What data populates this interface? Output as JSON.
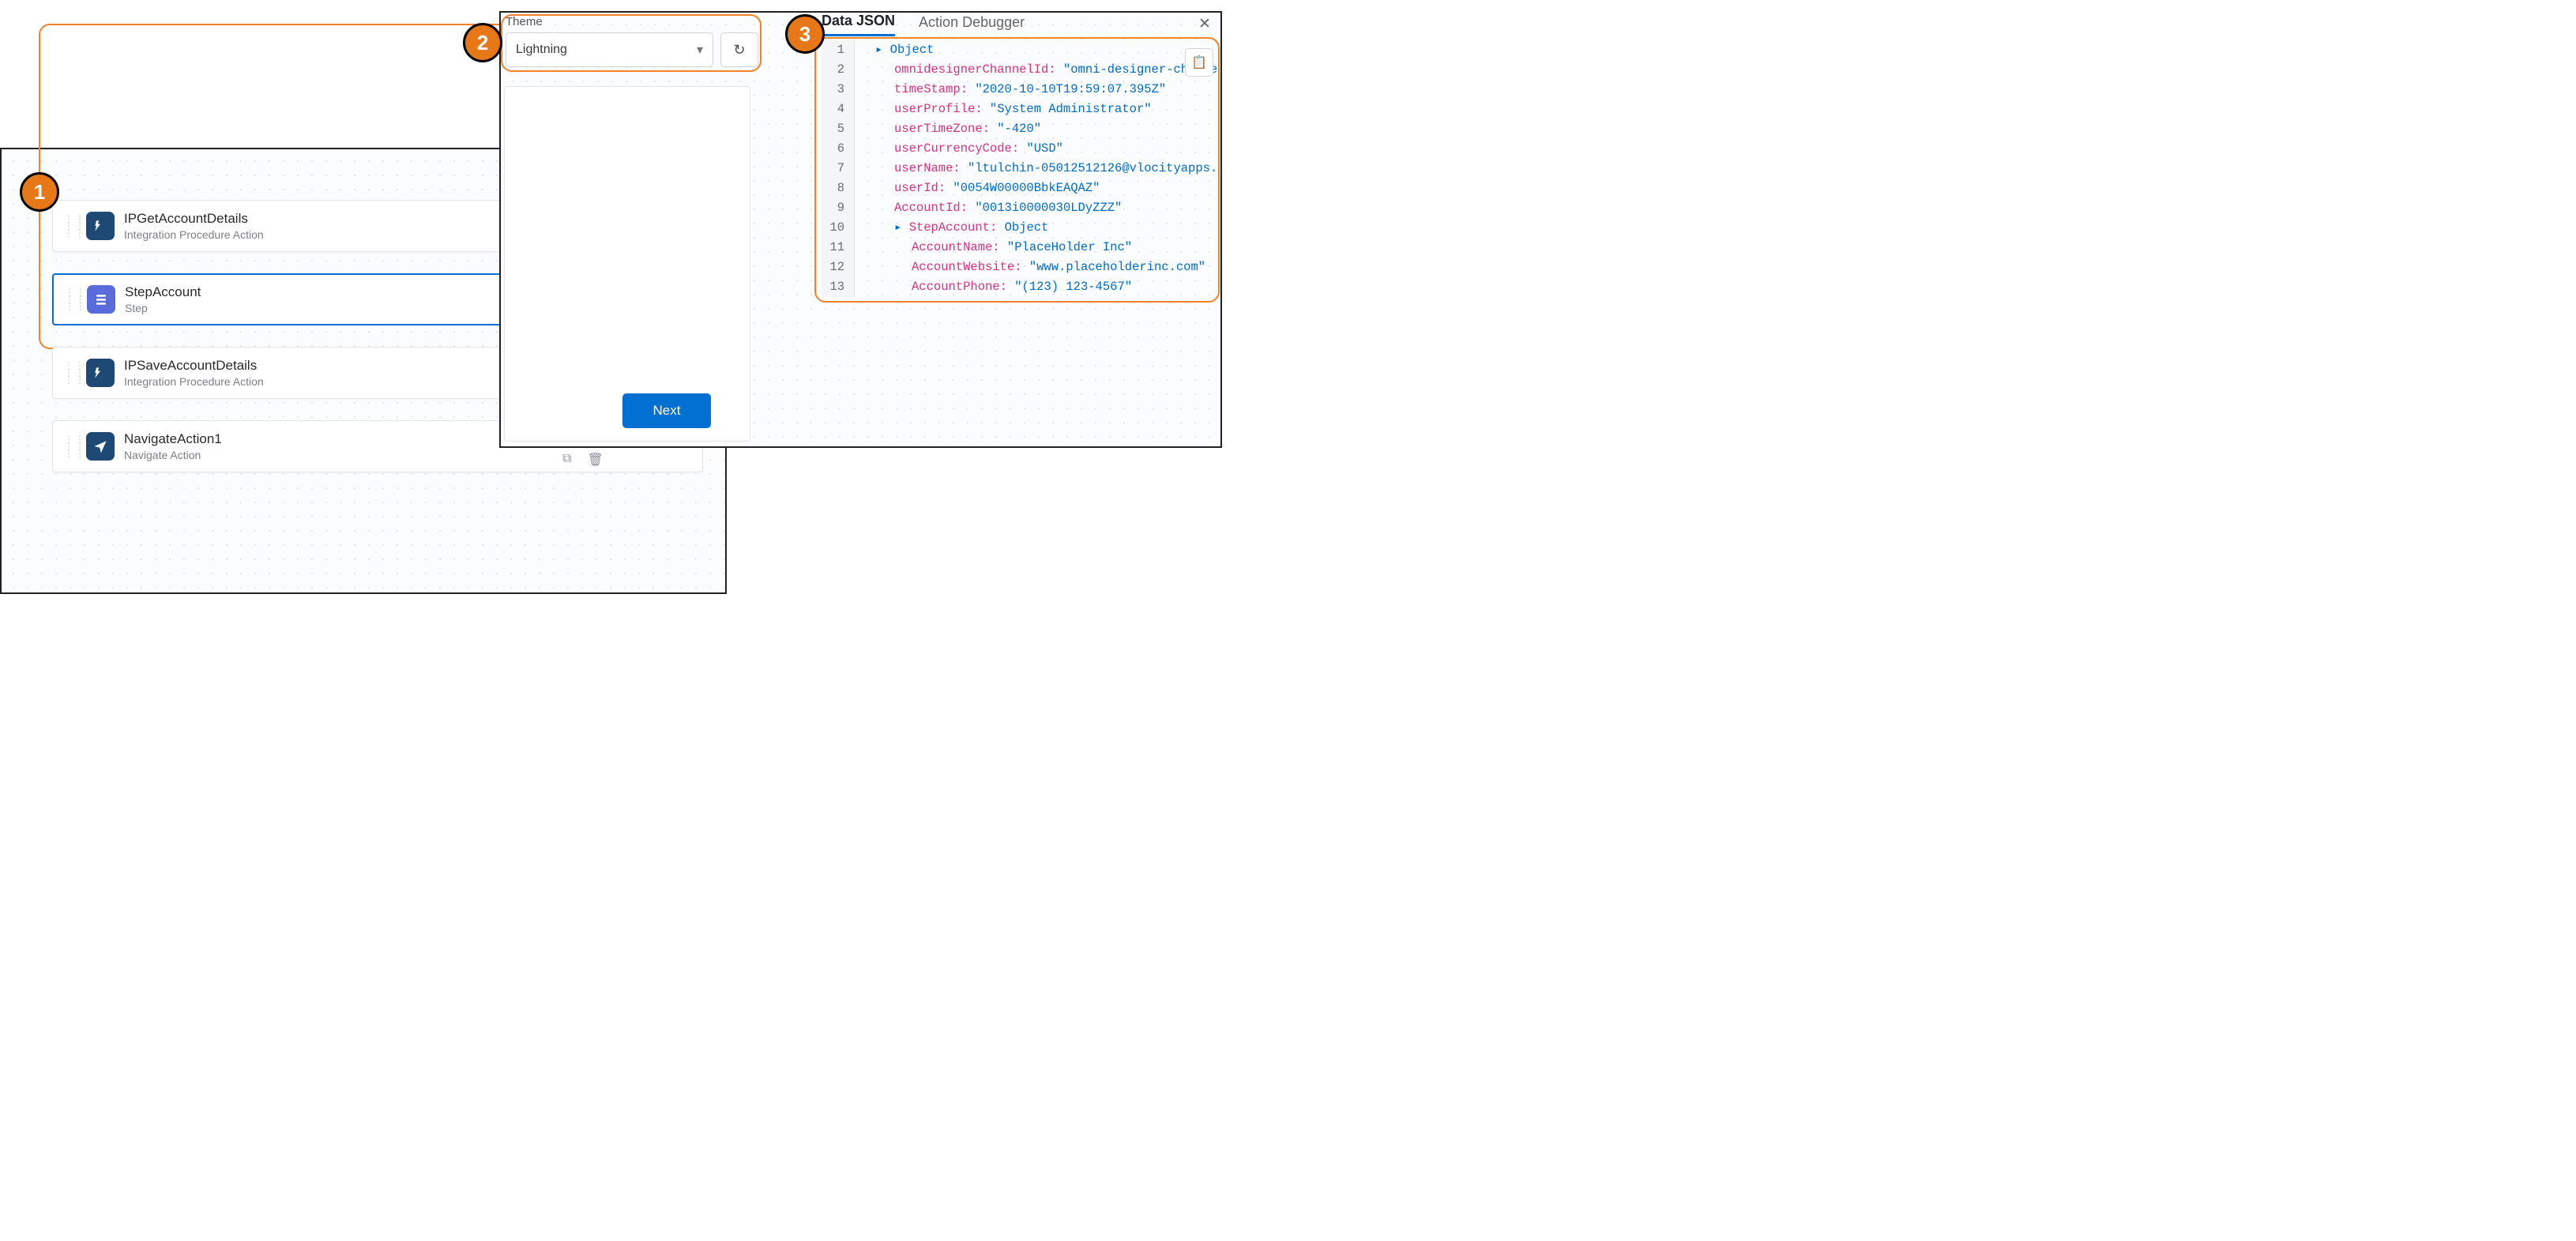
{
  "callouts": {
    "b1": "1",
    "b2": "2",
    "b3": "3"
  },
  "theme": {
    "label": "Theme",
    "value": "Lightning"
  },
  "preview": {
    "next_label": "Next"
  },
  "tabs": {
    "data_json": "Data JSON",
    "action_debugger": "Action Debugger"
  },
  "json_lines": [
    {
      "n": "1",
      "indent": 1,
      "arrow": true,
      "key": "",
      "val": "Object",
      "valcls": "tok-obj"
    },
    {
      "n": "2",
      "indent": 2,
      "arrow": false,
      "key": "omnidesignerChannelId:",
      "val": "\"omni-designer-channe",
      "valcls": "tok-str"
    },
    {
      "n": "3",
      "indent": 2,
      "arrow": false,
      "key": "timeStamp:",
      "val": "\"2020-10-10T19:59:07.395Z\"",
      "valcls": "tok-str"
    },
    {
      "n": "4",
      "indent": 2,
      "arrow": false,
      "key": "userProfile:",
      "val": "\"System Administrator\"",
      "valcls": "tok-str"
    },
    {
      "n": "5",
      "indent": 2,
      "arrow": false,
      "key": "userTimeZone:",
      "val": "\"-420\"",
      "valcls": "tok-str"
    },
    {
      "n": "6",
      "indent": 2,
      "arrow": false,
      "key": "userCurrencyCode:",
      "val": "\"USD\"",
      "valcls": "tok-str"
    },
    {
      "n": "7",
      "indent": 2,
      "arrow": false,
      "key": "userName:",
      "val": "\"ltulchin-05012512126@vlocityapps.",
      "valcls": "tok-str"
    },
    {
      "n": "8",
      "indent": 2,
      "arrow": false,
      "key": "userId:",
      "val": "\"0054W00000BbkEAQAZ\"",
      "valcls": "tok-str"
    },
    {
      "n": "9",
      "indent": 2,
      "arrow": false,
      "key": "AccountId:",
      "val": "\"0013i0000030LDyZZZ\"",
      "valcls": "tok-str"
    },
    {
      "n": "10",
      "indent": 2,
      "arrow": true,
      "key": "StepAccount:",
      "val": "Object",
      "valcls": "tok-obj"
    },
    {
      "n": "11",
      "indent": 3,
      "arrow": false,
      "key": "AccountName:",
      "val": "\"PlaceHolder Inc\"",
      "valcls": "tok-str"
    },
    {
      "n": "12",
      "indent": 3,
      "arrow": false,
      "key": "AccountWebsite:",
      "val": "\"www.placeholderinc.com\"",
      "valcls": "tok-str"
    },
    {
      "n": "13",
      "indent": 3,
      "arrow": false,
      "key": "AccountPhone:",
      "val": "\"(123) 123-4567\"",
      "valcls": "tok-str"
    }
  ],
  "steps": [
    {
      "title": "IPGetAccountDetails",
      "sub": "Integration Procedure Action",
      "icon": "ip",
      "selected": false
    },
    {
      "title": "StepAccount",
      "sub": "Step",
      "icon": "step",
      "selected": true
    },
    {
      "title": "IPSaveAccountDetails",
      "sub": "Integration Procedure Action",
      "icon": "ip",
      "selected": false
    },
    {
      "title": "NavigateAction1",
      "sub": "Navigate Action",
      "icon": "nav",
      "selected": false
    }
  ]
}
